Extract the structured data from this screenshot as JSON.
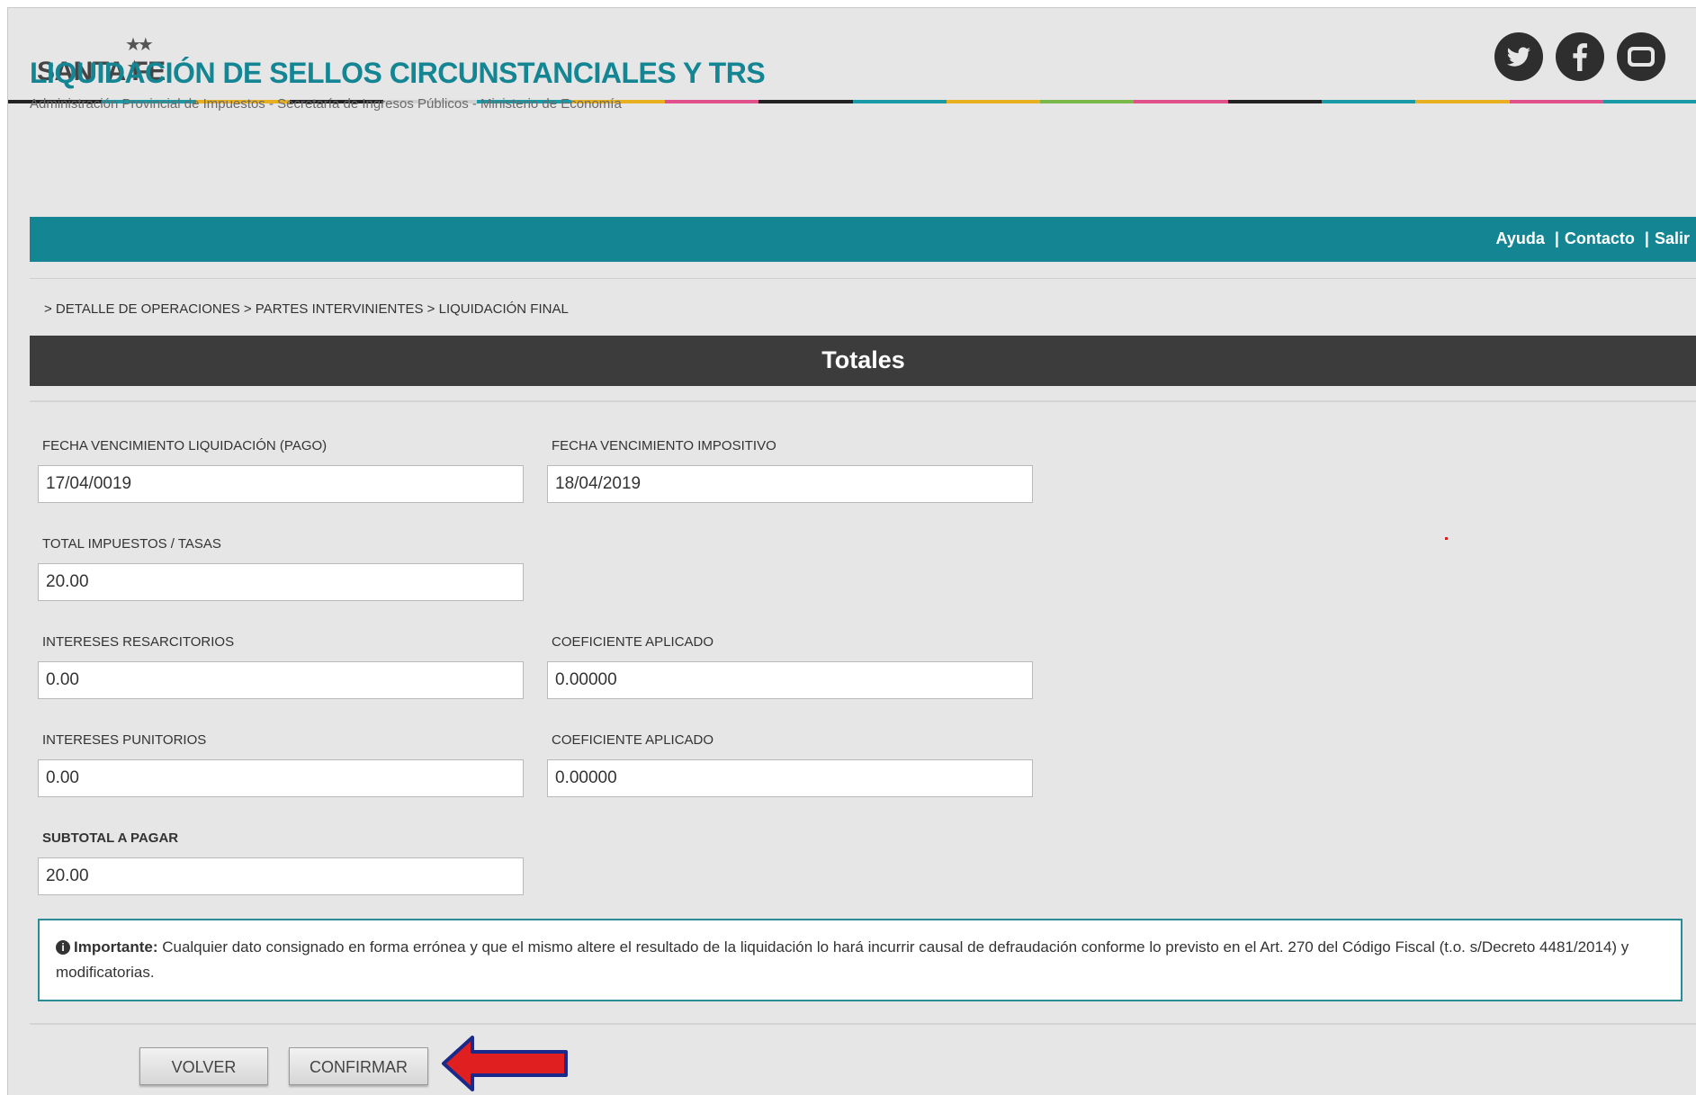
{
  "header": {
    "logo_text": "SANTA FE",
    "social": [
      {
        "name": "twitter-icon"
      },
      {
        "name": "facebook-icon"
      },
      {
        "name": "youtube-icon"
      }
    ],
    "stripe_colors": [
      "#222222",
      "#1a9aa5",
      "#e8b020",
      "#222222",
      "#d0d0d0",
      "#1a9aa5",
      "#e8b020",
      "#e0508a",
      "#222222",
      "#1a9aa5",
      "#e8b020",
      "#7ab84a",
      "#e0508a",
      "#222222",
      "#1a9aa5",
      "#e8b020",
      "#e0508a",
      "#1a9aa5"
    ]
  },
  "app": {
    "title": "LIQUIDACIÓN DE SELLOS CIRCUNSTANCIALES Y TRS",
    "subtitle": "Administración Provincial de Impuestos - Secretaría de Ingresos Públicos - Ministerio de Economía"
  },
  "nav": {
    "links": [
      "Ayuda",
      "Contacto",
      "Salir"
    ],
    "separator": "|"
  },
  "breadcrumb": "> DETALLE DE OPERACIONES > PARTES INTERVINIENTES > LIQUIDACIÓN FINAL",
  "section_title": "Totales",
  "fields": {
    "fecha_venc_liq": {
      "label": "FECHA VENCIMIENTO LIQUIDACIÓN (PAGO)",
      "value": "17/04/0019"
    },
    "fecha_venc_imp": {
      "label": "FECHA VENCIMIENTO IMPOSITIVO",
      "value": "18/04/2019"
    },
    "total_impuestos": {
      "label": "TOTAL IMPUESTOS / TASAS",
      "value": "20.00"
    },
    "int_resarcitorios": {
      "label": "INTERESES RESARCITORIOS",
      "value": "0.00"
    },
    "coef_resarcitorios": {
      "label": "COEFICIENTE APLICADO",
      "value": "0.00000"
    },
    "int_punitorios": {
      "label": "INTERESES PUNITORIOS",
      "value": "0.00"
    },
    "coef_punitorios": {
      "label": "COEFICIENTE APLICADO",
      "value": "0.00000"
    },
    "subtotal": {
      "label": "SUBTOTAL A PAGAR",
      "value": "20.00"
    }
  },
  "notice": {
    "icon": "info-icon",
    "emphasis": "Importante:",
    "text": " Cualquier dato consignado en forma errónea y que el mismo altere el resultado de la liquidación lo hará incurrir causal de defraudación conforme lo previsto en el Art. 270 del Código Fiscal (t.o. s/Decreto 4481/2014) y modificatorias."
  },
  "buttons": {
    "back": "VOLVER",
    "confirm": "CONFIRMAR"
  },
  "annotation": {
    "arrow_color": "#e02020",
    "arrow_outline": "#1a2a8a"
  }
}
